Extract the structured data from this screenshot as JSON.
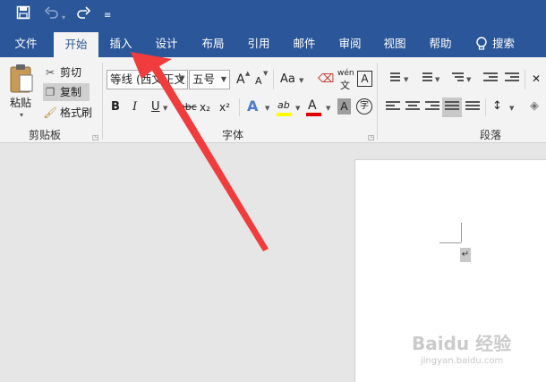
{
  "quick_access": {
    "save_icon": "save-icon",
    "undo_icon": "undo-icon",
    "redo_icon": "redo-icon",
    "customize_icon": "customize-qat-icon"
  },
  "tabs": [
    {
      "label": "文件"
    },
    {
      "label": "开始"
    },
    {
      "label": "插入"
    },
    {
      "label": "设计"
    },
    {
      "label": "布局"
    },
    {
      "label": "引用"
    },
    {
      "label": "邮件"
    },
    {
      "label": "审阅"
    },
    {
      "label": "视图"
    },
    {
      "label": "帮助"
    }
  ],
  "search": {
    "label": "搜索"
  },
  "clipboard": {
    "paste_label": "粘贴",
    "cut_label": "剪切",
    "copy_label": "复制",
    "format_painter_label": "格式刷",
    "group_label": "剪贴板"
  },
  "font": {
    "font_name": "等线 (西文正文",
    "font_size": "五号",
    "grow": "A",
    "shrink": "A",
    "change_case": "Aa",
    "phonetic": "wén",
    "bold": "B",
    "italic": "I",
    "underline": "U",
    "strikethrough": "abc",
    "subscript": "x₂",
    "superscript": "x²",
    "text_effect": "A",
    "highlight": "ab",
    "font_color": "A",
    "shading": "A",
    "enclose": "字",
    "group_label": "字体"
  },
  "paragraph": {
    "group_label": "段落"
  },
  "document": {
    "paragraph_mark": "↵"
  },
  "watermark": {
    "brand": "Baidu 经验",
    "url": "jingyan.baidu.com"
  },
  "colors": {
    "title_bar": "#2b579a",
    "ribbon_bg": "#f3f3f3",
    "arrow_red": "#f03c3c",
    "font_color_bar": "#e00000",
    "highlight_bar": "#ffff00"
  }
}
